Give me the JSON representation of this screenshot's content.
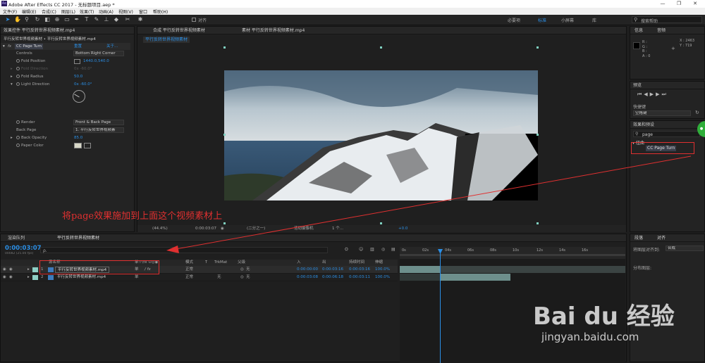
{
  "app": {
    "title": "Adobe After Effects CC 2017 - 无标题项目.aep *",
    "win_buttons": [
      "—",
      "❐",
      "✕"
    ]
  },
  "menu": [
    "文件(F)",
    "编辑(E)",
    "合成(C)",
    "图层(L)",
    "效果(T)",
    "动画(A)",
    "视图(V)",
    "窗口",
    "帮助(H)"
  ],
  "toolbar": {
    "snap_label": "对齐",
    "workspaces": [
      "必要项",
      "标准",
      "小屏幕",
      "库"
    ],
    "search_placeholder": "搜索帮助"
  },
  "effect_controls": {
    "tab": "效果控件 平行反转世界视频素材.mp4",
    "breadcrumb": "平行反转世界视频素材 • 平行反转世界视频素材.mp4",
    "effect_name": "CC Page Turn",
    "reset": "重置",
    "about": "关于...",
    "rows": [
      {
        "label": "Controls",
        "value": "Bottom Right Corner"
      },
      {
        "label": "Fold Position",
        "value": "1440.0,540.0"
      },
      {
        "label": "Fold Direction",
        "value": "0x -60.0°"
      },
      {
        "label": "Fold Radius",
        "value": "50.0"
      },
      {
        "label": "Light Direction",
        "value": "0x -60.0°"
      },
      {
        "label": "Render",
        "value": "Front & Back Page"
      },
      {
        "label": "Back Page",
        "value": "1. 平行反转世界视频素"
      },
      {
        "label": "Back Opacity",
        "value": "85.0"
      },
      {
        "label": "Paper Color",
        "value": ""
      }
    ]
  },
  "composition": {
    "tab": "合成 平行反转世界视频素材",
    "footage_tab": "素材 平行反转世界视频素材.mp4",
    "comp_chip": "平行反转世界视频素材",
    "annotation": "将page效果施加到上面这个视频素材上",
    "footer": {
      "zoom": "(44.4%)",
      "timecode": "0:00:03:07",
      "res": "(二分之一)",
      "camera": "活动摄像机",
      "views": "1 个...",
      "exposure": "+0.0"
    }
  },
  "info": {
    "tabs": [
      "信息",
      "音频"
    ],
    "rgba": [
      "R :",
      "G :",
      "B :",
      "A : 0"
    ],
    "coords": [
      "X : 2463",
      "Y : 719"
    ]
  },
  "preview": {
    "tab": "预览",
    "shortcut_label": "快捷键",
    "shortcut_value": "空格键"
  },
  "effects": {
    "tab": "效果和预设",
    "search": "page",
    "category": "▾ 扭曲",
    "result": "CC Page Turn"
  },
  "paragraph": {
    "tabs": [
      "段落",
      "对齐"
    ],
    "align_label": "将图层对齐到:",
    "align_value": "合成",
    "distribute": "分布图层:"
  },
  "timeline": {
    "tabs": [
      "渲染队列",
      "平行反转世界视频素材"
    ],
    "timecode": "0:00:03:07",
    "fps": "00082 (25.00 fps)",
    "search_placeholder": "ρ.",
    "columns": [
      "源名称",
      "单☆\\fx ⊙◎◉",
      "模式",
      "T",
      "TrkMat",
      "父级",
      "入",
      "出",
      "持续时间",
      "伸缩"
    ],
    "ruler": [
      "0s",
      "02s",
      "04s",
      "06s",
      "08s",
      "10s",
      "12s",
      "14s",
      "16s"
    ],
    "layers": [
      {
        "num": "1",
        "name": "平行反转世界视频素材.mp4",
        "mode": "正常",
        "trk": "",
        "parent": "无",
        "in": "0:00:00:00",
        "out": "0:00:03:16",
        "dur": "0:00:03:16",
        "stretch": "100.0%"
      },
      {
        "num": "2",
        "name": "平行反转世界视频素材.mp4",
        "mode": "正常",
        "trk": "无",
        "parent": "无",
        "in": "0:00:03:08",
        "out": "0:00:06:18",
        "dur": "0:00:03:11",
        "stretch": "100.0%"
      }
    ]
  },
  "watermark": {
    "brand": "Bai du 经验",
    "url": "jingyan.baidu.com"
  },
  "colors": {
    "accent": "#2b8fe6",
    "annotation": "#e03030",
    "bg": "#1e1e1e"
  }
}
